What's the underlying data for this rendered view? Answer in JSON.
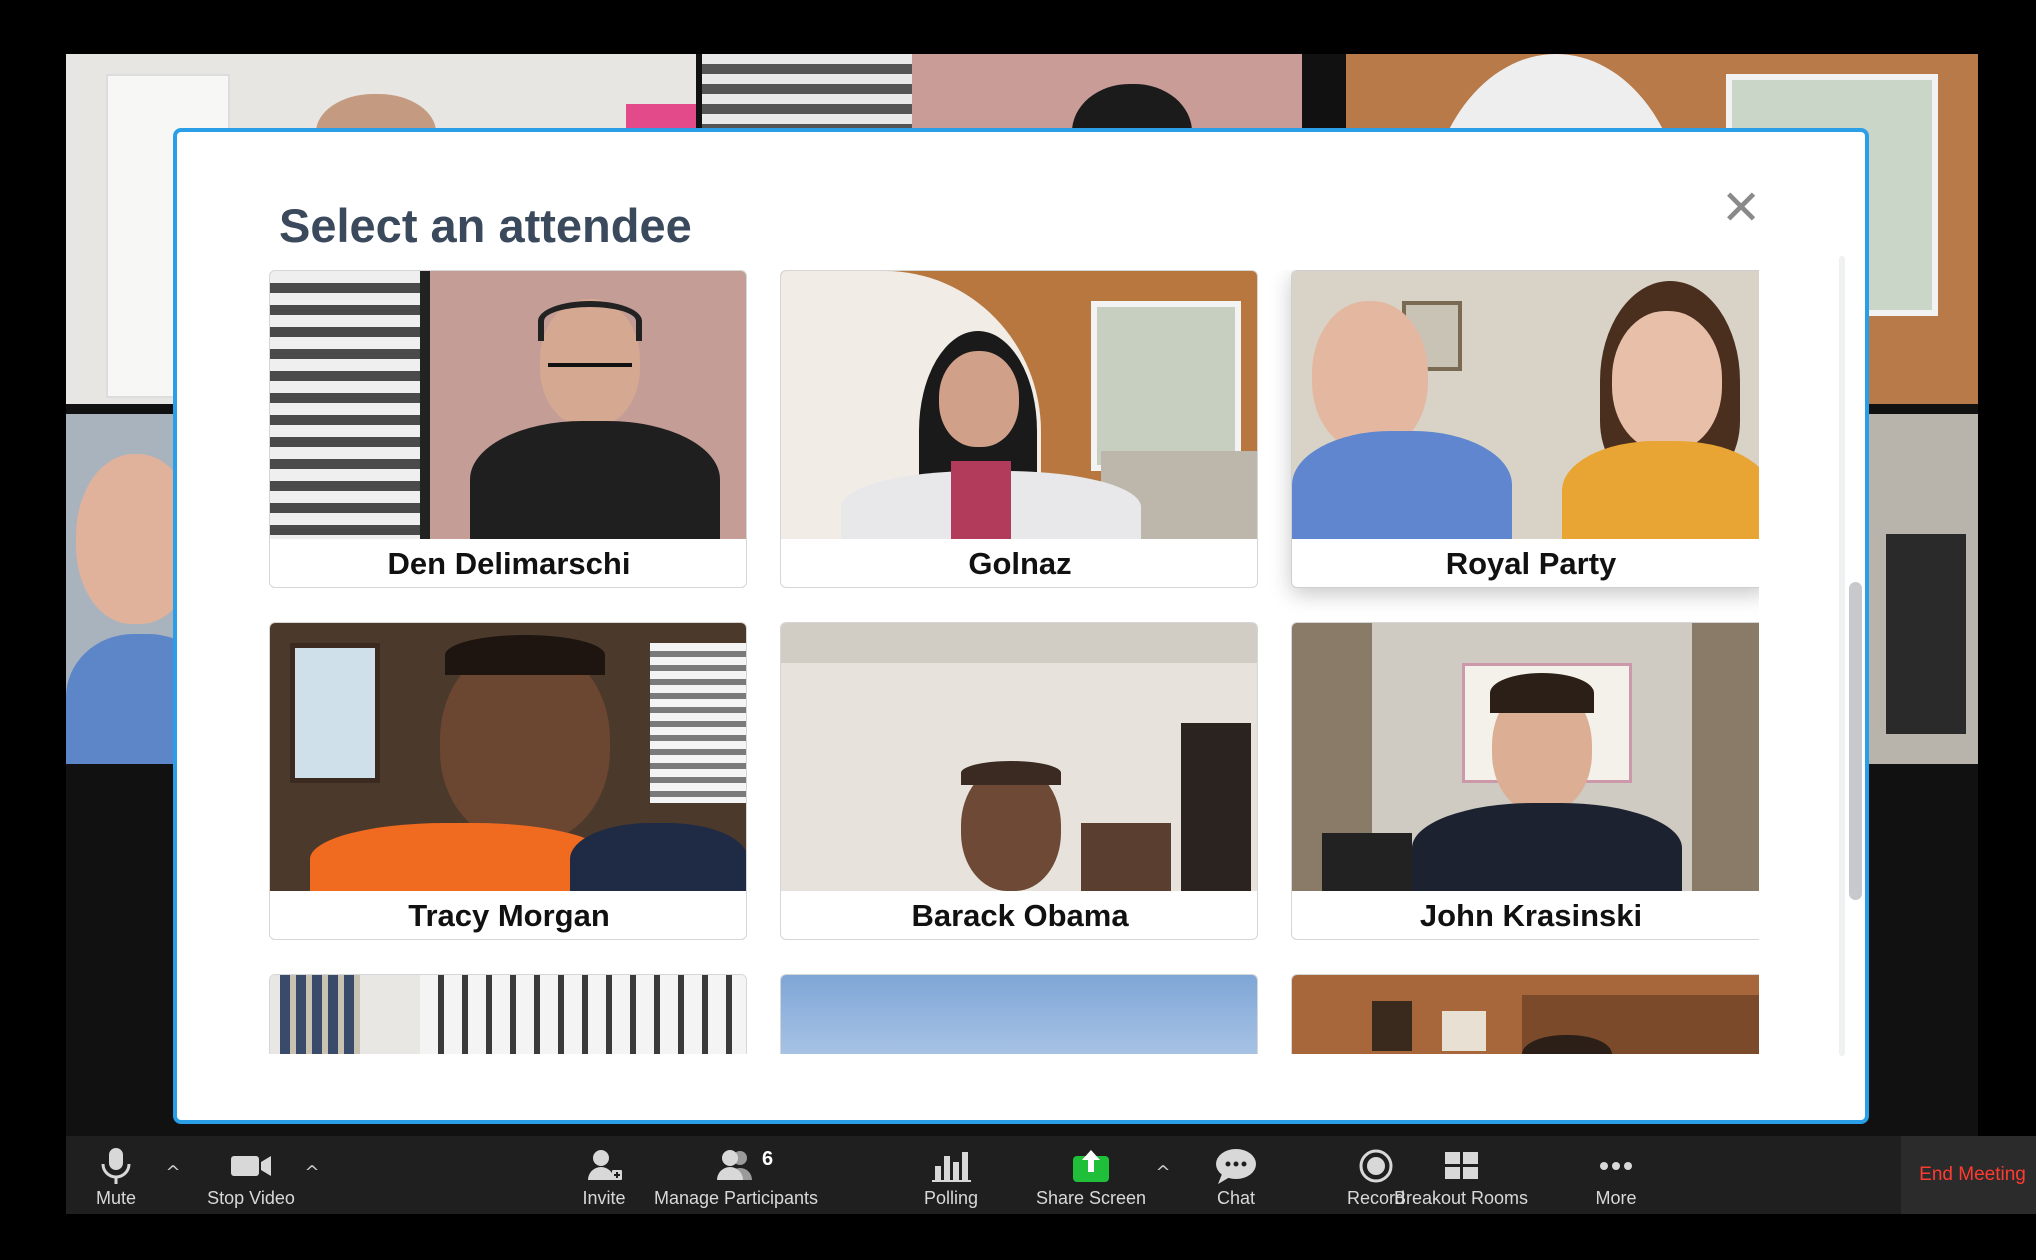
{
  "modal": {
    "title": "Select an attendee",
    "close_glyph": "✕"
  },
  "attendees": [
    {
      "name": "Den Delimarschi"
    },
    {
      "name": "Golnaz"
    },
    {
      "name": "Royal Party",
      "selected": true
    },
    {
      "name": "Tracy Morgan"
    },
    {
      "name": "Barack Obama"
    },
    {
      "name": "John Krasinski"
    }
  ],
  "toolbar": {
    "mute_label": "Mute",
    "stop_video_label": "Stop Video",
    "invite_label": "Invite",
    "manage_participants_label": "Manage Participants",
    "participant_count": "6",
    "polling_label": "Polling",
    "share_screen_label": "Share Screen",
    "chat_label": "Chat",
    "record_label": "Record",
    "breakout_rooms_label": "Breakout Rooms",
    "more_label": "More",
    "end_meeting_label": "End Meeting",
    "caret_glyph": "^"
  },
  "colors": {
    "modal_border": "#2a9fe8",
    "share_screen_green": "#1fbf3a",
    "end_meeting_red": "#ff3b30",
    "title_color": "#3a4a5c"
  }
}
